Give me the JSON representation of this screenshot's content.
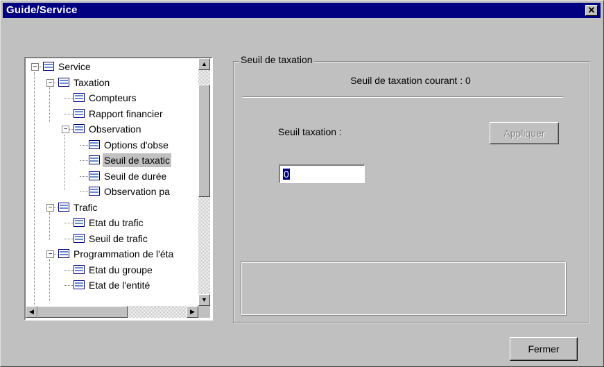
{
  "window": {
    "title": "Guide/Service",
    "close_glyph": "✕"
  },
  "tree": {
    "items": [
      {
        "label": "Service",
        "expander": "−"
      },
      {
        "label": "Taxation",
        "expander": "−"
      },
      {
        "label": "Compteurs"
      },
      {
        "label": "Rapport financier"
      },
      {
        "label": "Observation",
        "expander": "−"
      },
      {
        "label": "Options d'obse"
      },
      {
        "label": "Seuil de taxatic",
        "selected": true
      },
      {
        "label": "Seuil de durée"
      },
      {
        "label": "Observation pa"
      },
      {
        "label": "Trafic",
        "expander": "−"
      },
      {
        "label": "Etat du trafic"
      },
      {
        "label": "Seuil de trafic"
      },
      {
        "label": "Programmation de l'éta",
        "expander": "−"
      },
      {
        "label": "Etat du groupe"
      },
      {
        "label": "Etat de l'entité"
      }
    ],
    "icon": "document-list-icon"
  },
  "panel": {
    "group_title": "Seuil de taxation",
    "current_text": "Seuil de taxation courant : 0",
    "input_label": "Seuil taxation :",
    "input_value": "0",
    "apply_label": "Appliquer"
  },
  "footer": {
    "close_label": "Fermer"
  },
  "colors": {
    "titlebar": "#000080",
    "face": "#c0c0c0",
    "selection": "#000080"
  }
}
